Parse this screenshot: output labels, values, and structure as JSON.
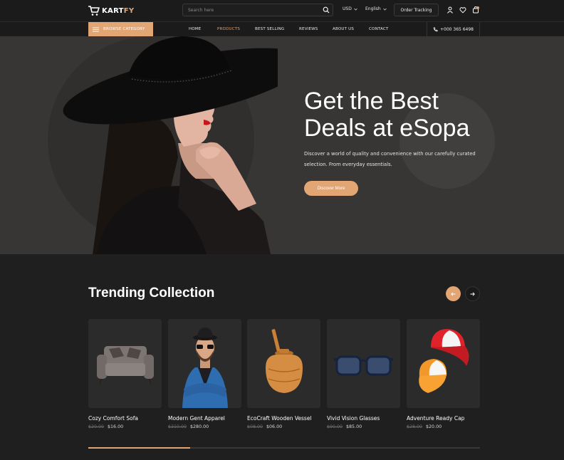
{
  "header": {
    "logo_main": "KART",
    "logo_accent": "FY",
    "search_placeholder": "Search here",
    "currency": "USD",
    "language": "English",
    "order_tracking": "Order Tracking",
    "icons": [
      "user-icon",
      "heart-icon",
      "cart-icon"
    ]
  },
  "nav": {
    "browse_label": "BROWSE CATEGORY",
    "items": [
      {
        "label": "HOME",
        "active": false
      },
      {
        "label": "PRODUCTS",
        "active": true
      },
      {
        "label": "BEST SELLING",
        "active": false
      },
      {
        "label": "REVIEWS",
        "active": false
      },
      {
        "label": "ABOUT US",
        "active": false
      },
      {
        "label": "CONTACT",
        "active": false
      }
    ],
    "phone": "+000 365 6498"
  },
  "hero": {
    "title_line1": "Get the Best",
    "title_line2": "Deals at eSopa",
    "description": "Discover a world of quality and convenience with our carefully curated selection. From everyday essentials.",
    "button": "Discover More"
  },
  "trending": {
    "title": "Trending Collection",
    "products": [
      {
        "name": "Cozy Comfort Sofa",
        "old_price": "$20.00",
        "price": "$16.00",
        "icon": "sofa-image"
      },
      {
        "name": "Modern Gent Apparel",
        "old_price": "$310.00",
        "price": "$280.00",
        "icon": "man-apparel-image"
      },
      {
        "name": "EcoCraft Wooden Vessel",
        "old_price": "$08.00",
        "price": "$06.00",
        "icon": "wooden-vessel-image"
      },
      {
        "name": "Vivid Vision Glasses",
        "old_price": "$90.00",
        "price": "$85.00",
        "icon": "glasses-image"
      },
      {
        "name": "Adventure Ready Cap",
        "old_price": "$28.00",
        "price": "$20.00",
        "icon": "caps-image"
      }
    ],
    "progress": 0.26
  },
  "colors": {
    "accent": "#e2a574",
    "background": "#1f1f1f",
    "hero_bg": "#383634"
  }
}
